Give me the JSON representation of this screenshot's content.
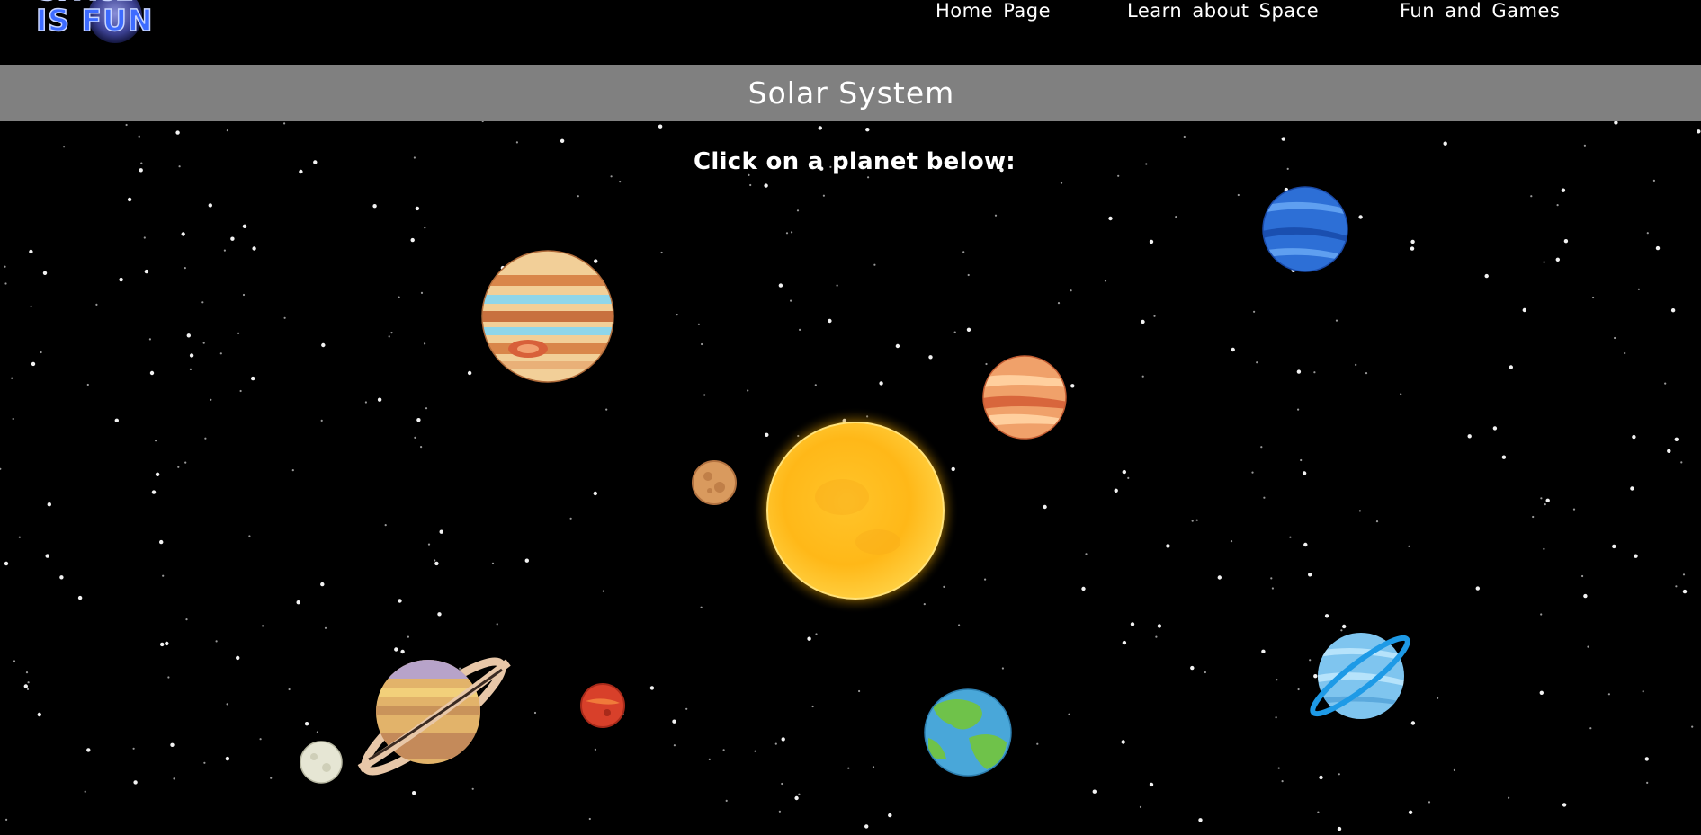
{
  "logo": {
    "line1": "SPACE",
    "line2": "IS FUN",
    "colors": {
      "text": "#4d7bff",
      "glow": "#1b3cff"
    }
  },
  "nav": [
    {
      "label": "Home Page"
    },
    {
      "label": "Learn about Space"
    },
    {
      "label": "Fun and Games"
    }
  ],
  "page_title": "Solar System",
  "instruction": "Click on a planet below:",
  "bodies": [
    {
      "name": "Sun",
      "icon": "sun-icon"
    },
    {
      "name": "Mercury",
      "icon": "mercury-icon"
    },
    {
      "name": "Venus",
      "icon": "venus-icon"
    },
    {
      "name": "Earth",
      "icon": "earth-icon"
    },
    {
      "name": "Mars",
      "icon": "mars-icon"
    },
    {
      "name": "Jupiter",
      "icon": "jupiter-icon"
    },
    {
      "name": "Saturn",
      "icon": "saturn-icon"
    },
    {
      "name": "Uranus",
      "icon": "uranus-icon"
    },
    {
      "name": "Neptune",
      "icon": "neptune-icon"
    },
    {
      "name": "Pluto",
      "icon": "pluto-icon"
    }
  ],
  "colors": {
    "background": "#000000",
    "title_bar": "#808080",
    "text": "#ffffff"
  }
}
